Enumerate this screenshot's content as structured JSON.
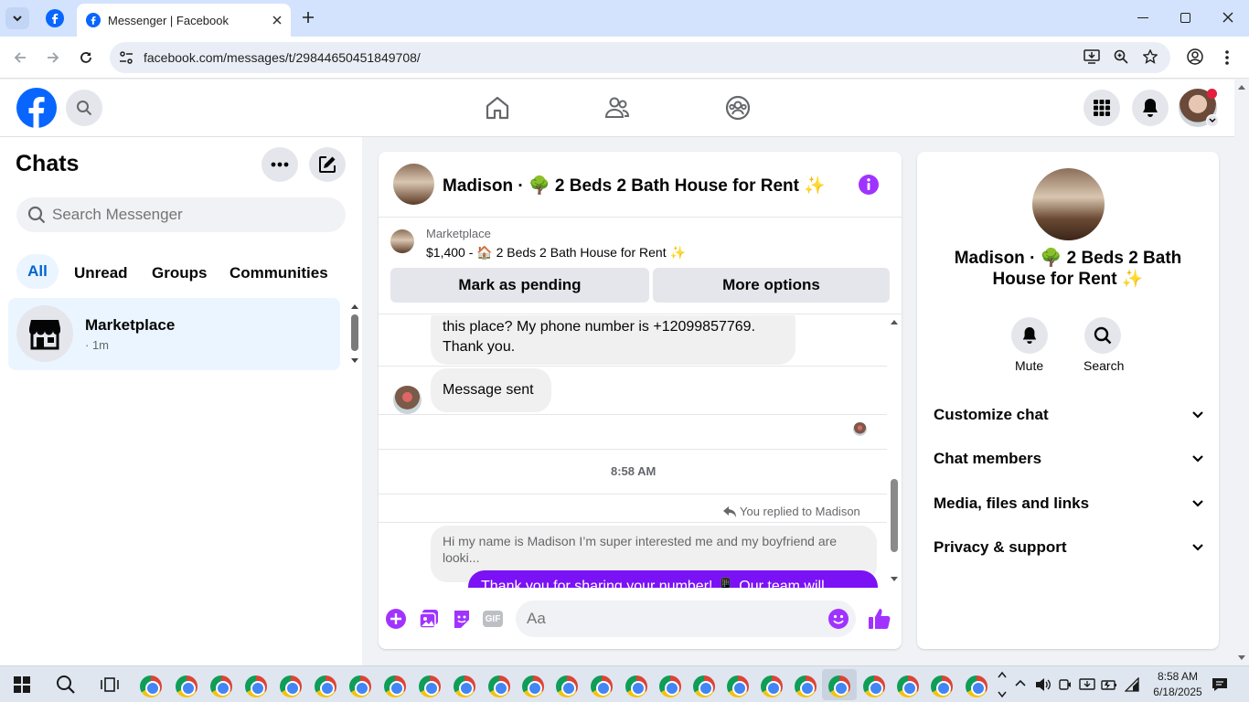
{
  "browser": {
    "tab_title": "Messenger | Facebook",
    "url": "facebook.com/messages/t/29844650451849708/"
  },
  "left": {
    "title": "Chats",
    "search_placeholder": "Search Messenger",
    "filters": [
      "All",
      "Unread",
      "Groups",
      "Communities"
    ],
    "chat_item": {
      "name": "Marketplace",
      "meta": "· 1m"
    }
  },
  "chat": {
    "header_title": "Madison · 🌳 2 Beds 2 Bath House for Rent ✨",
    "listing_source": "Marketplace",
    "listing_text": "$1,400 - 🏠 2 Beds 2 Bath House for Rent ✨",
    "mark_pending": "Mark as pending",
    "more_options": "More options",
    "msg1_line1": "this place? My phone number is +12099857769.",
    "msg1_line2": "Thank you.",
    "msg2": "Message sent",
    "timestamp": "8:58 AM",
    "replied_label": "You replied to Madison",
    "quoted": "Hi my name is Madison I’m super interested me and my boyfriend are looki...",
    "sent_partial": "Thank you for sharing your number! 📱 Our team will",
    "composer_placeholder": "Aa"
  },
  "right": {
    "title": "Madison · 🌳 2 Beds 2 Bath House for Rent ✨",
    "mute": "Mute",
    "search": "Search",
    "sections": [
      "Customize chat",
      "Chat members",
      "Media, files and links",
      "Privacy & support"
    ]
  },
  "taskbar": {
    "time": "8:58 AM",
    "date": "6/18/2025"
  },
  "colors": {
    "fb_blue": "#0866ff",
    "messenger_purple": "#a033ff",
    "sent_bubble": "#7a12f5"
  }
}
